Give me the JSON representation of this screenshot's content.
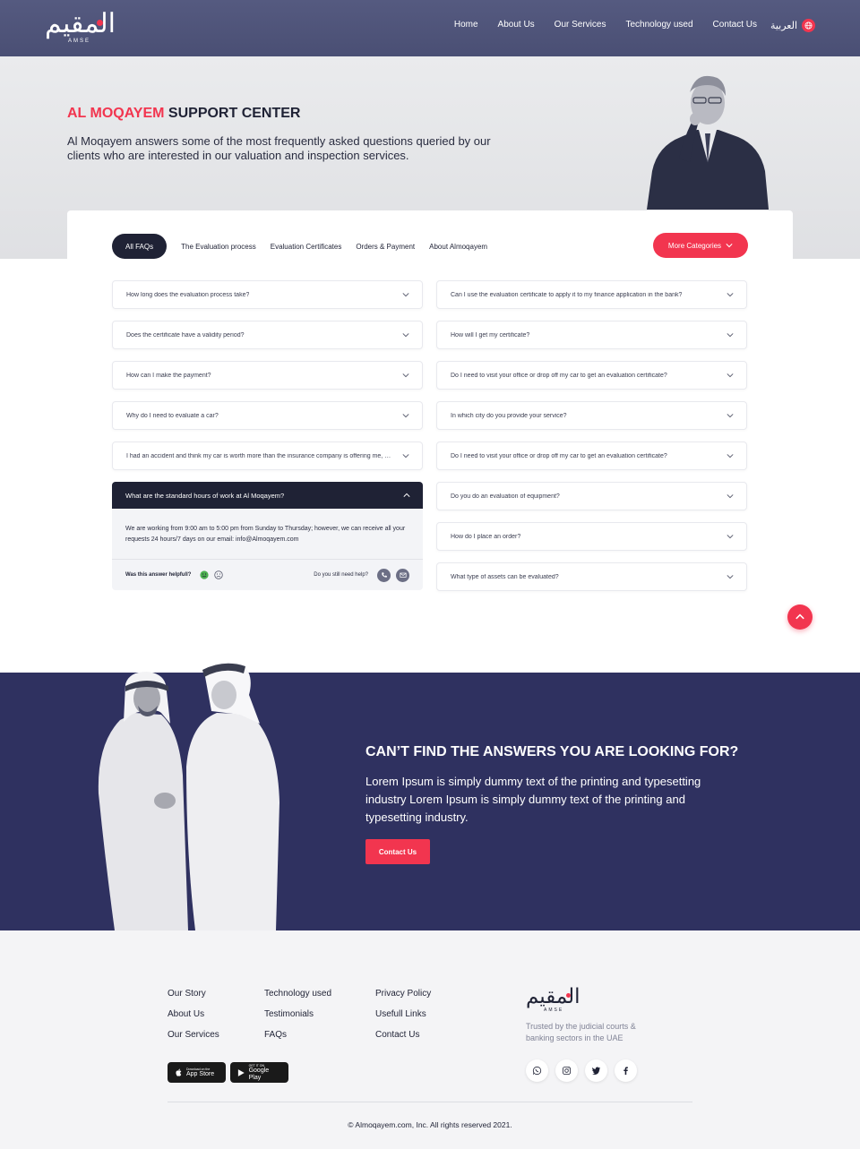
{
  "nav": {
    "logo_ar": "المقيم",
    "logo_en": "AMSE",
    "links": [
      "Home",
      "About Us",
      "Our Services",
      "Technology used",
      "Contact Us"
    ],
    "lang": "العربية"
  },
  "hero": {
    "title_accent": "AL MOQAYEM",
    "title_rest": " SUPPORT CENTER",
    "description": "Al Moqayem answers some of the most frequently asked questions queried by our clients who are interested in our valuation and inspection services."
  },
  "faq": {
    "tabs": [
      "All FAQs",
      "The Evaluation process",
      "Evaluation Certificates",
      "Orders & Payment",
      "About Almoqayem"
    ],
    "more_label": "More Categories",
    "left": [
      "How long does the evaluation process take?",
      "Does the certificate have a validity period?",
      "How can I make the payment?",
      "Why do I need to evaluate a car?",
      " I had an accident and think my car is worth more than the insurance company is offering me, What should I do?"
    ],
    "open": {
      "question": "What are the standard hours of work at Al Moqayem?",
      "answer": "We are working from 9:00 am to 5:00 pm from Sunday to Thursday; however, we can receive all your requests 24 hours/7 days on our email: info@Almoqayem.com",
      "helpful_label": "Was this answer helpfull?",
      "need_help_label": "Do you still need help?"
    },
    "right": [
      "Can  I use the evaluation certificate to apply it to my finance application in the bank?",
      "How will I get my certificate?",
      "Do I need to visit your office or drop off my car to get an evaluation certificate?",
      "In which city do you provide your service?",
      "Do I need to visit your office or drop off my car to get an evaluation certificate?",
      "Do you do an evaluation of equipment?",
      "How do I place an order?",
      "What type of assets can be evaluated?"
    ]
  },
  "cta": {
    "title": "CAN’T FIND THE ANSWERS YOU ARE LOOKING FOR?",
    "description": "Lorem Ipsum is simply dummy text of the printing and typesetting industry Lorem Ipsum is simply dummy text of the printing and typesetting industry.",
    "button": "Contact Us"
  },
  "footer": {
    "col1": [
      "Our Story",
      "About Us",
      "Our Services"
    ],
    "col2": [
      "Technology used",
      "Testimonials",
      "FAQs"
    ],
    "col3": [
      "Privacy Policy",
      "Usefull Links",
      "Contact Us"
    ],
    "app_store_small": "Download on the",
    "app_store_big": "App Store",
    "play_small": "GET IT ON",
    "play_big": "Google Play",
    "logo_ar": "المقيم",
    "logo_en": "AMSE",
    "trusted": "Trusted by the judicial courts & banking sectors in the UAE",
    "copyright": "© Almoqayem.com, Inc. All rights reserved 2021."
  },
  "colors": {
    "accent": "#f2354f",
    "navy": "#2f3160",
    "dark": "#1f2235"
  }
}
